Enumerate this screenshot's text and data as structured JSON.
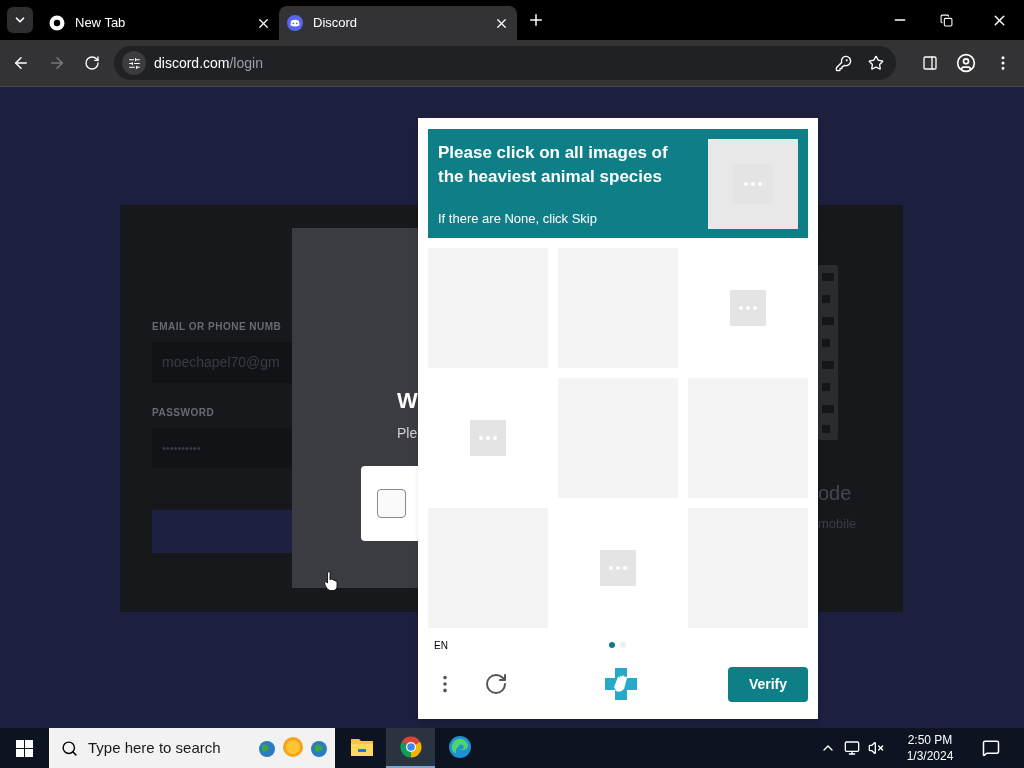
{
  "browser": {
    "tabs": [
      {
        "title": "New Tab",
        "kind": "chrome",
        "selected": false
      },
      {
        "title": "Discord",
        "kind": "discord",
        "selected": true
      }
    ],
    "address": {
      "host": "discord.com",
      "path": "/login"
    },
    "forward_disabled": true
  },
  "login": {
    "email_label": "EMAIL OR PHONE NUMB",
    "email_value": "moechapel70@gm",
    "password_label": "PASSWORD",
    "password_value": "••••••••••",
    "side_title": "ode",
    "side_text": "mobile"
  },
  "verify_modal": {
    "title": "W",
    "text": "Ple",
    "checked": false
  },
  "captcha": {
    "prompt": "Please click on all images of the heaviest animal species",
    "hint": "If there are None, click Skip",
    "cells": [
      {
        "kind": "blank"
      },
      {
        "kind": "blank"
      },
      {
        "kind": "loading"
      },
      {
        "kind": "loading"
      },
      {
        "kind": "blank"
      },
      {
        "kind": "blank"
      },
      {
        "kind": "blank"
      },
      {
        "kind": "loading"
      },
      {
        "kind": "blank"
      }
    ],
    "language": "EN",
    "pages": [
      {
        "selected": true
      },
      {
        "selected": false
      }
    ],
    "verify": "Verify"
  },
  "taskbar": {
    "search_placeholder": "Type here to search",
    "apps": [
      {
        "kind": "explorer",
        "selected": false
      },
      {
        "kind": "chrome",
        "selected": true
      },
      {
        "kind": "edge",
        "selected": false
      }
    ],
    "time": "2:50 PM",
    "date": "1/3/2024"
  }
}
